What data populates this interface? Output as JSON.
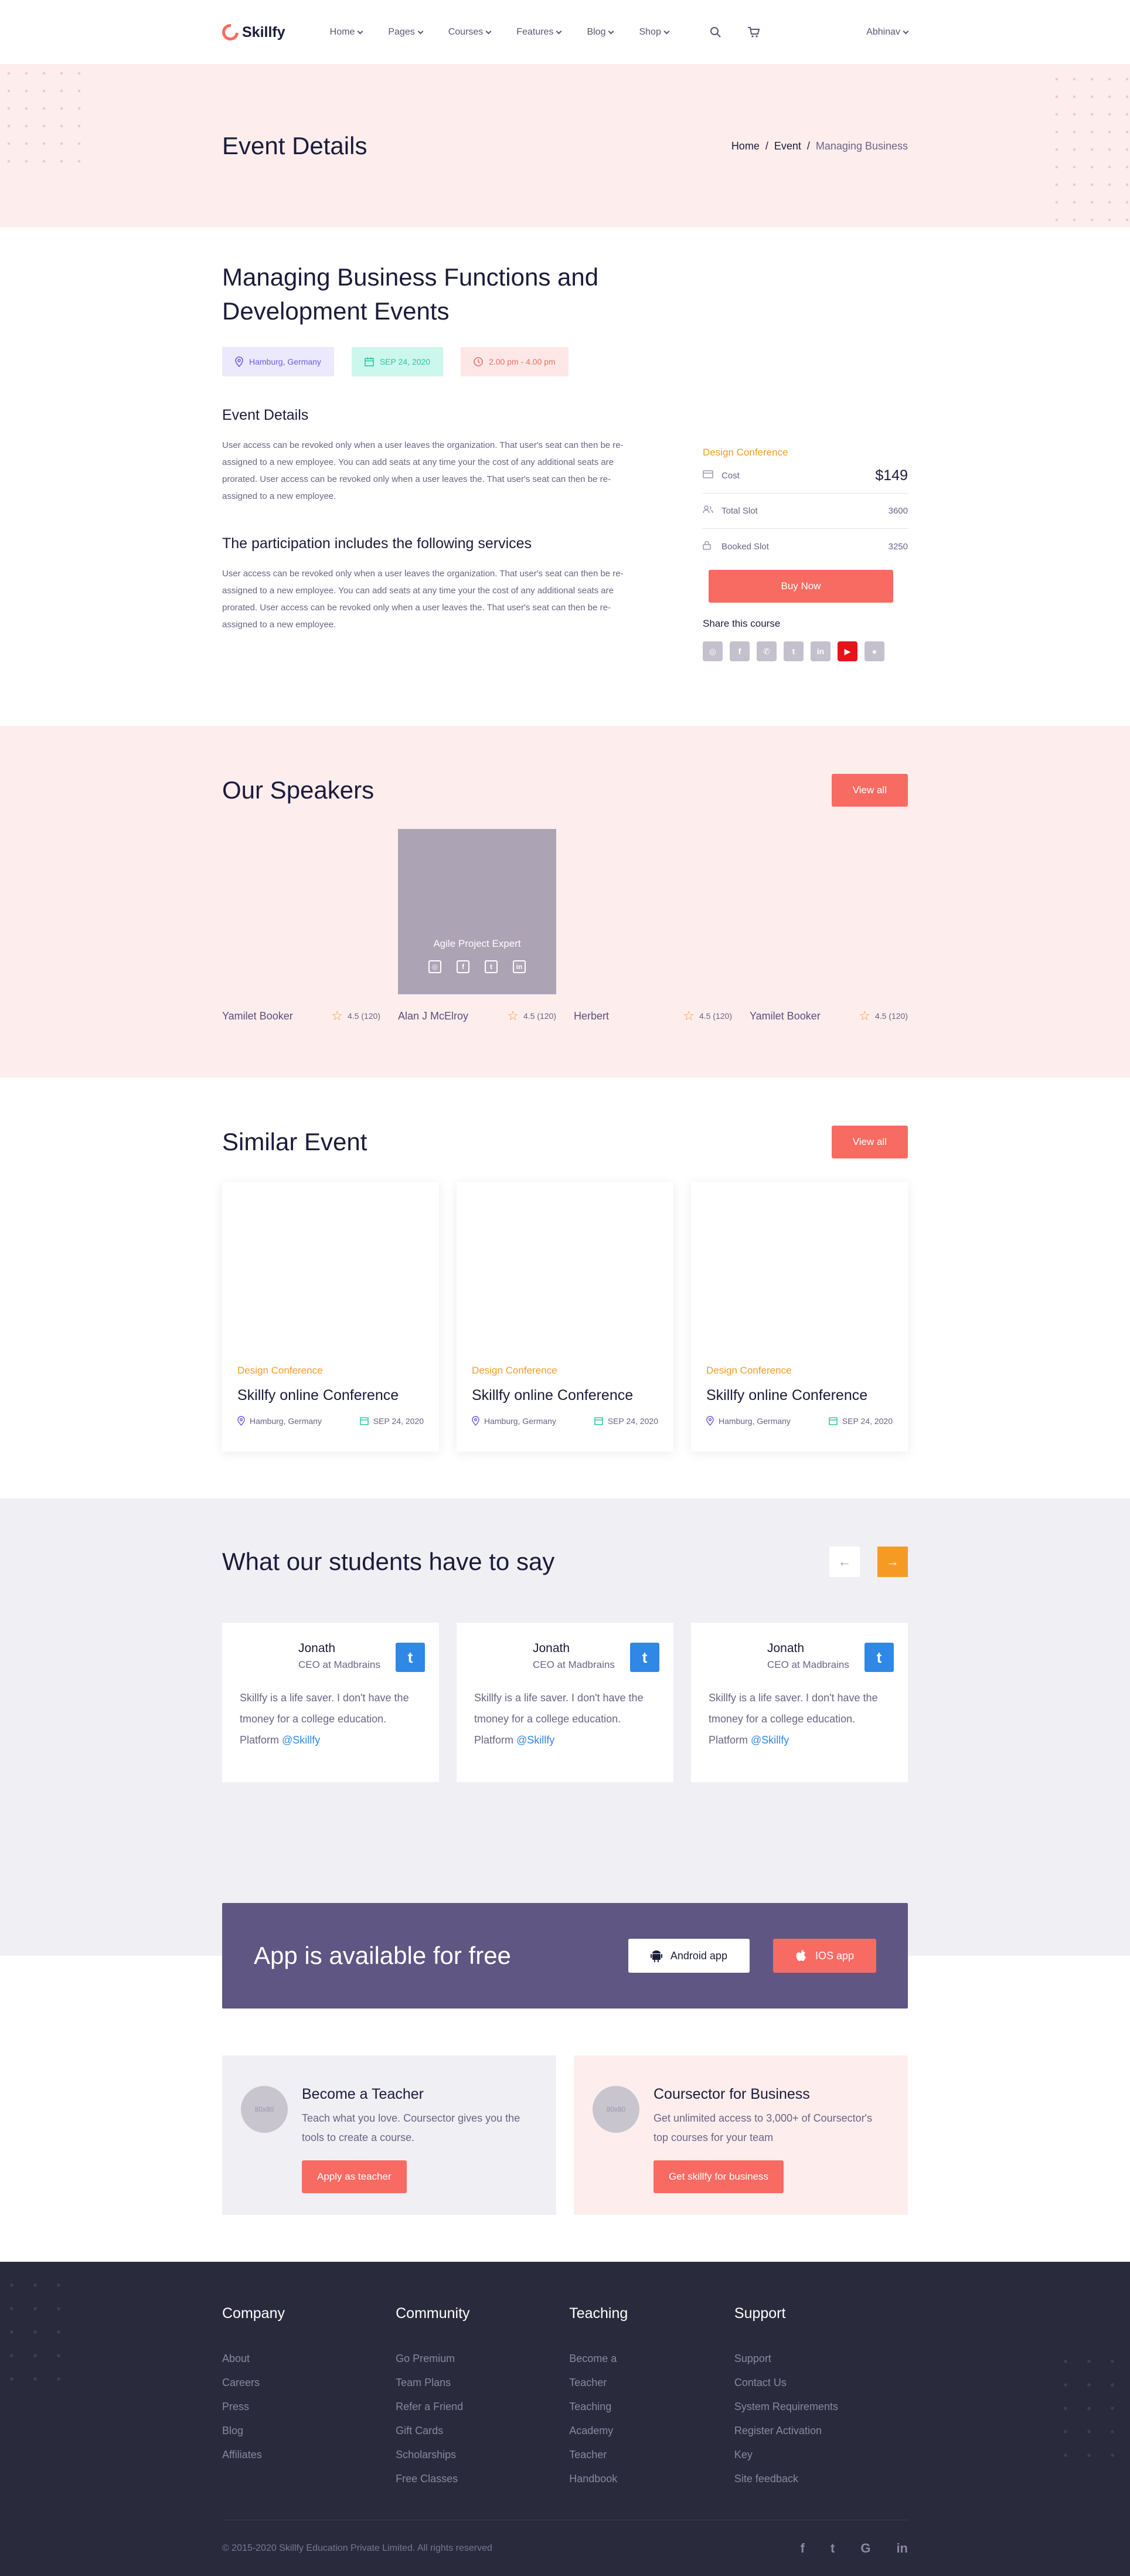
{
  "header": {
    "brand": "Skillfy",
    "nav": [
      "Home",
      "Pages",
      "Courses",
      "Features",
      "Blog",
      "Shop"
    ],
    "user": "Abhinav"
  },
  "banner": {
    "title": "Event Details",
    "crumbs": [
      "Home",
      "Event",
      "Managing Business"
    ]
  },
  "event": {
    "title_line1": "Managing Business Functions and",
    "title_line2": "Development Events",
    "location": "Hamburg, Germany",
    "date": "SEP 24, 2020",
    "time": "2.00 pm - 4.00 pm",
    "details_heading": "Event Details",
    "details_text": "User access can be revoked only when a user leaves the organization. That user's seat can then be re-assigned to a new employee. You can add seats at any time your the cost of any additional seats are prorated. User access can be revoked only when a user leaves the. That user's seat can then be re-assigned to a new employee.",
    "services_heading": "The participation includes the following services",
    "services_text": "User access can be revoked only when a user leaves the organization. That user's seat can then be re-assigned to a new employee. You can add seats at any time your the cost of any additional seats are prorated. User access can be revoked only when a user leaves the. That user's seat can then be re-assigned to a new employee."
  },
  "sidebar": {
    "category": "Design Conference",
    "cost_label": "Cost",
    "cost_value": "$149",
    "total_label": "Total Slot",
    "total_value": "3600",
    "booked_label": "Booked Slot",
    "booked_value": "3250",
    "buy_label": "Buy Now",
    "share_label": "Share this course"
  },
  "speakers": {
    "title": "Our Speakers",
    "view_all": "View all",
    "hover_role": "Agile Project Expert",
    "items": [
      {
        "name": "Yamilet Booker",
        "rating": "4.5 (120)"
      },
      {
        "name": "Alan J McElroy",
        "rating": "4.5 (120)"
      },
      {
        "name": "Herbert",
        "rating": "4.5 (120)"
      },
      {
        "name": "Yamilet Booker",
        "rating": "4.5 (120)"
      }
    ]
  },
  "similar": {
    "title": "Similar Event",
    "view_all": "View all",
    "items": [
      {
        "category": "Design Conference",
        "title": "Skillfy online Conference",
        "location": "Hamburg, Germany",
        "date": "SEP 24, 2020"
      },
      {
        "category": "Design Conference",
        "title": "Skillfy online Conference",
        "location": "Hamburg, Germany",
        "date": "SEP 24, 2020"
      },
      {
        "category": "Design Conference",
        "title": "Skillfy online Conference",
        "location": "Hamburg, Germany",
        "date": "SEP 24, 2020"
      }
    ]
  },
  "testimonials": {
    "title": "What our students have to say",
    "items": [
      {
        "name": "Jonath",
        "role": "CEO at Madbrains",
        "text": "Skillfy is a life saver. I don't have the tmoney for a college education. Platform ",
        "handle": "@Skillfy"
      },
      {
        "name": "Jonath",
        "role": "CEO at Madbrains",
        "text": "Skillfy is a life saver. I don't have the tmoney for a college education. Platform ",
        "handle": "@Skillfy"
      },
      {
        "name": "Jonath",
        "role": "CEO at Madbrains",
        "text": "Skillfy is a life saver. I don't have the tmoney for a college education. Platform ",
        "handle": "@Skillfy"
      }
    ]
  },
  "app": {
    "title": "App is available for free",
    "android": "Android app",
    "ios": "IOS app"
  },
  "cta": {
    "teacher": {
      "avatar": "80x80",
      "title": "Become a Teacher",
      "text": "Teach what you love. Coursector gives you the tools to create a course.",
      "button": "Apply as teacher"
    },
    "business": {
      "avatar": "80x80",
      "title": "Coursector for Business",
      "text": "Get unlimited access to 3,000+ of Coursector's top courses for your team",
      "button": "Get skillfy for business"
    }
  },
  "footer": {
    "columns": [
      {
        "title": "Company",
        "links": [
          "About",
          "Careers",
          "Press",
          "Blog",
          "Affiliates"
        ]
      },
      {
        "title": "Community",
        "links": [
          "Go Premium",
          "Team Plans",
          "Refer a Friend",
          "Gift Cards",
          "Scholarships",
          "Free Classes"
        ]
      },
      {
        "title": "Teaching",
        "links": [
          "Become a",
          "Teacher",
          "Teaching",
          "Academy",
          "Teacher",
          "Handbook"
        ]
      },
      {
        "title": "Support",
        "links": [
          "Support",
          "Contact Us",
          "System Requirements",
          "Register Activation",
          "Key",
          "Site feedback"
        ]
      }
    ],
    "copyright": "© 2015-2020 Skillfy Education Private Limited. All rights reserved"
  },
  "colors": {
    "accent": "#f76b63",
    "orange": "#f59b24",
    "purple": "#5f5683",
    "footer": "#2a2a3d"
  }
}
